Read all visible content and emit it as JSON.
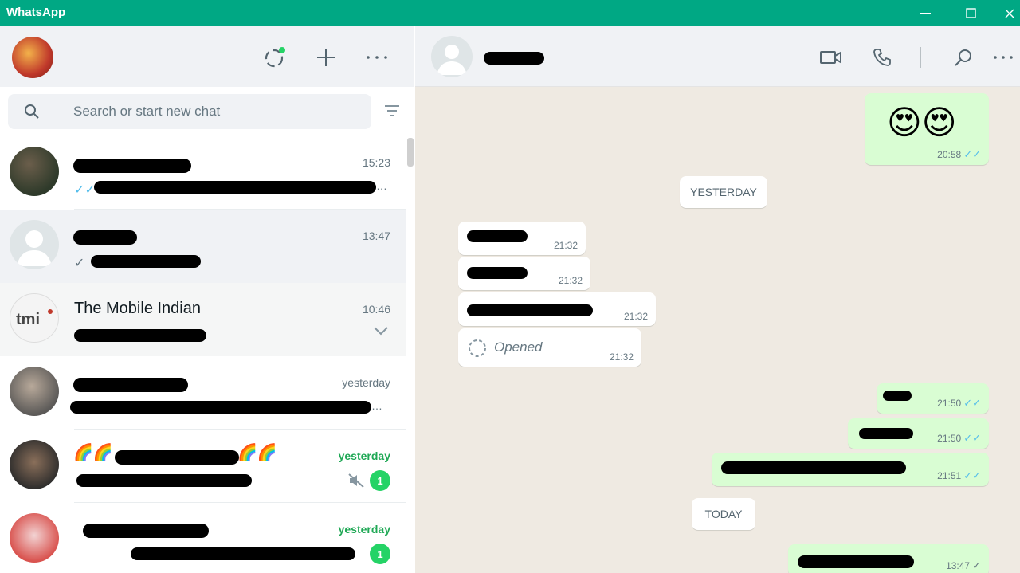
{
  "window": {
    "title": "WhatsApp",
    "minimize": "—",
    "maximize": "☐",
    "close": "✕"
  },
  "sidebar": {
    "search_placeholder": "Search or start new chat",
    "chats": [
      {
        "time": "15:23"
      },
      {
        "time": "13:47"
      },
      {
        "name": "The Mobile Indian",
        "time": "10:46"
      },
      {
        "time": "yesterday"
      },
      {
        "time": "yesterday",
        "unread": "1"
      },
      {
        "time": "yesterday",
        "unread": "1"
      }
    ]
  },
  "conversation": {
    "messages": [
      {
        "emoji": "😍😍",
        "time": "20:58"
      },
      {
        "time": "21:32"
      },
      {
        "time": "21:32"
      },
      {
        "time": "21:32"
      },
      {
        "label": "Opened",
        "time": "21:32"
      },
      {
        "time": "21:50"
      },
      {
        "time": "21:50"
      },
      {
        "time": "21:51"
      },
      {
        "time": "13:47"
      }
    ],
    "days": [
      "YESTERDAY",
      "TODAY"
    ]
  },
  "colors": {
    "brand": "#00a884",
    "outgoing_bubble": "#d9fdd3",
    "unread_badge": "#25d366",
    "read_ticks": "#53bdeb"
  },
  "icons": [
    "status-icon",
    "new-chat-icon",
    "menu-icon",
    "search-icon",
    "filter-icon",
    "video-call-icon",
    "voice-call-icon",
    "chevron-down-icon",
    "mute-icon"
  ]
}
